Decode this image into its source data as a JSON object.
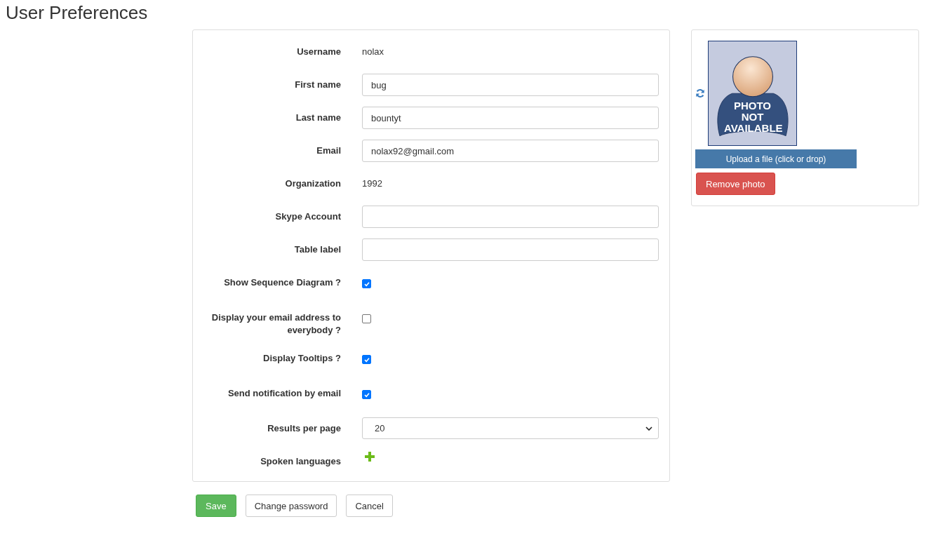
{
  "page_title": "User Preferences",
  "fields": [
    {
      "kind": "static",
      "label": "Username",
      "value": "nolax"
    },
    {
      "kind": "input",
      "label": "First name",
      "value": "bug"
    },
    {
      "kind": "input",
      "label": "Last name",
      "value": "bountyt"
    },
    {
      "kind": "input",
      "label": "Email",
      "value": "nolax92@gmail.com"
    },
    {
      "kind": "static",
      "label": "Organization",
      "value": "1992"
    },
    {
      "kind": "input",
      "label": "Skype Account"
    },
    {
      "kind": "input",
      "label": "Table label"
    },
    {
      "kind": "checkbox",
      "label": "Show Sequence Diagram ?",
      "checked": true
    },
    {
      "kind": "checkbox",
      "label": "Display your email address to everybody ?",
      "checked": false
    },
    {
      "kind": "checkbox",
      "label": "Display Tooltips ?",
      "checked": true
    },
    {
      "kind": "checkbox",
      "label": "Send notification by email",
      "checked": true
    },
    {
      "kind": "select",
      "label": "Results per page",
      "value": "20"
    },
    {
      "kind": "add",
      "label": "Spoken languages"
    }
  ],
  "photo": {
    "placeholder_text": "PHOTO NOT AVAILABLE",
    "upload_label": "Upload a file (click or drop)",
    "remove_label": "Remove photo"
  },
  "buttons": [
    {
      "kind": "primary",
      "label": "Save"
    },
    {
      "kind": "default",
      "label": "Change password"
    },
    {
      "kind": "default",
      "label": "Cancel"
    }
  ]
}
